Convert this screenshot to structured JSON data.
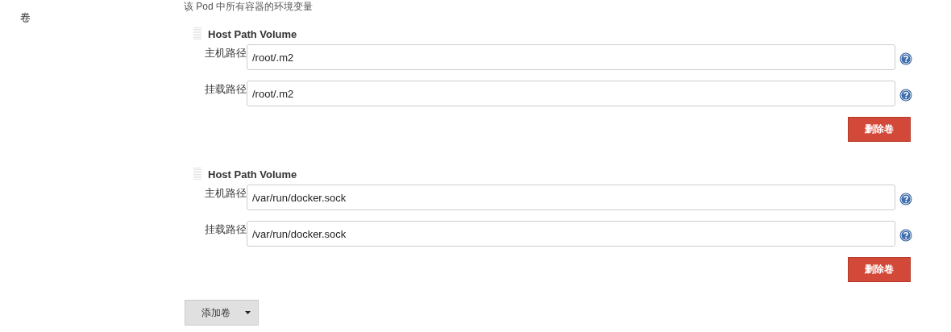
{
  "description": "该 Pod 中所有容器的环境变量",
  "section_label": "卷",
  "volumes": [
    {
      "title": "Host Path Volume",
      "fields": [
        {
          "label": "主机路径",
          "value": "/root/.m2"
        },
        {
          "label": "挂载路径",
          "value": "/root/.m2"
        }
      ],
      "delete_button": "删除卷"
    },
    {
      "title": "Host Path Volume",
      "fields": [
        {
          "label": "主机路径",
          "value": "/var/run/docker.sock"
        },
        {
          "label": "挂载路径",
          "value": "/var/run/docker.sock"
        }
      ],
      "delete_button": "删除卷"
    }
  ],
  "add_button": "添加卷"
}
